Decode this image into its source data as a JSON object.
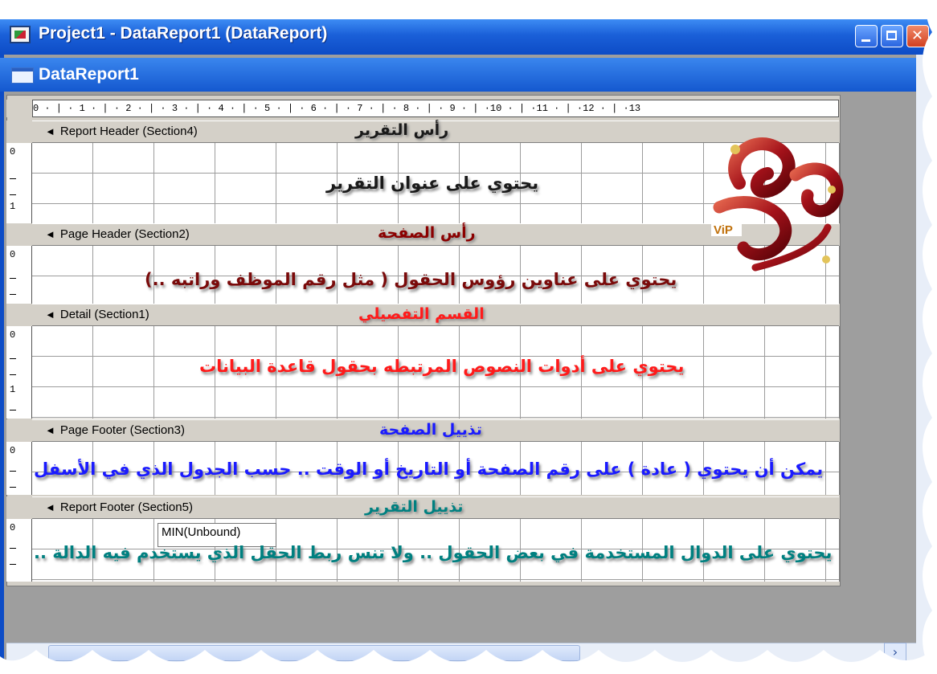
{
  "window": {
    "title": "Project1 - DataReport1 (DataReport)",
    "inner_title": "DataReport1"
  },
  "ruler": {
    "text": "0 · | · 1 · | · 2 · | · 3 · | · 4 · | · 5 · | · 6 · | · 7 · | · 8 · | · 9 · | ·10 · | ·11 · | ·12 · | ·13"
  },
  "bands": [
    {
      "label": "Report Header (Section4)",
      "arabic": "رأس التقرير",
      "color": "#1a1a1a"
    },
    {
      "label": "Page Header (Section2)",
      "arabic": "رأس الصفحة",
      "color": "#8b0000"
    },
    {
      "label": "Detail (Section1)",
      "arabic": "القسم التفصيلي",
      "color": "#ff1a1a"
    },
    {
      "label": "Page Footer (Section3)",
      "arabic": "تذييل الصفحة",
      "color": "#1a1aff"
    },
    {
      "label": "Report Footer (Section5)",
      "arabic": "تذييل التقرير",
      "color": "#008080"
    }
  ],
  "sections": [
    {
      "text": "يحتوي على عنوان التقرير",
      "color": "#1a1a1a"
    },
    {
      "text": "يحتوي على عناوين رؤوس الحقول ( مثل رقم الموظف وراتبه ..)",
      "color": "#7a0a0a"
    },
    {
      "text": "يحتوي على أدوات النصوص المرتبطه بحقول قاعدة البيانات",
      "color": "#ff1a1a"
    },
    {
      "text": "يمكن أن يحتوي ( عادة ) على رقم الصفحة أو التاريخ أو الوقت .. حسب الجدول الذي في الأسفل",
      "color": "#1a1aff"
    },
    {
      "text": "يحتوي على الدوال المستخدمة في بعض الحقول .. ولا تنس ربط الحقل الذي يستخدم فيه الدالة ..",
      "color": "#008080"
    }
  ],
  "unbound_label": "MIN(Unbound)",
  "logo_badge": "ViP",
  "vruler": {
    "zero": "0",
    "one": "1"
  },
  "icons": {
    "band_arrow": "band-collapse-arrow-icon",
    "scroll_right": "chevron-right-icon"
  }
}
